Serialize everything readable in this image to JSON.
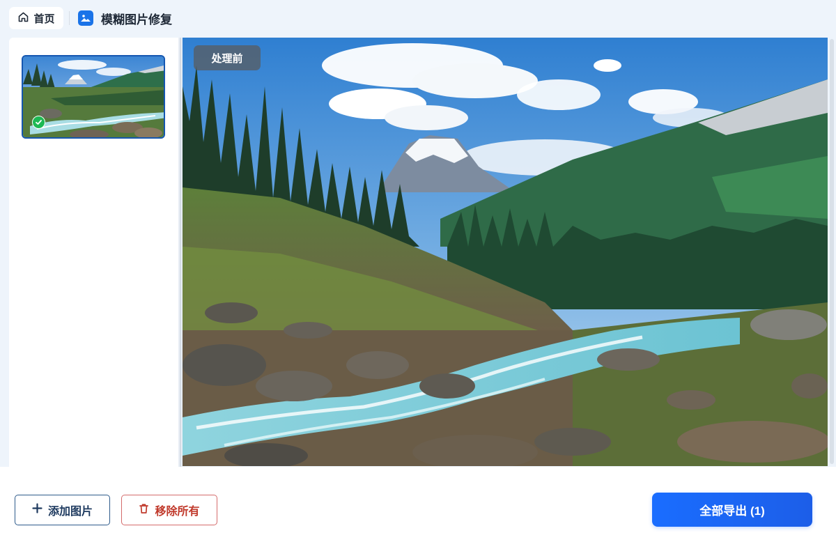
{
  "header": {
    "home_label": "首页",
    "app_title": "模糊图片修复"
  },
  "sidebar": {
    "thumbnails": [
      {
        "selected": true,
        "status": "done"
      }
    ]
  },
  "preview": {
    "badge_label": "处理前"
  },
  "actions": {
    "add_label": "添加图片",
    "remove_label": "移除所有",
    "export_label": "全部导出 (1)"
  },
  "colors": {
    "accent": "#1a6dff",
    "danger": "#c0392b",
    "success": "#1db954",
    "background": "#eef4fb"
  },
  "icons": [
    "home-icon",
    "image-icon",
    "check-icon",
    "plus-icon",
    "trash-icon"
  ]
}
